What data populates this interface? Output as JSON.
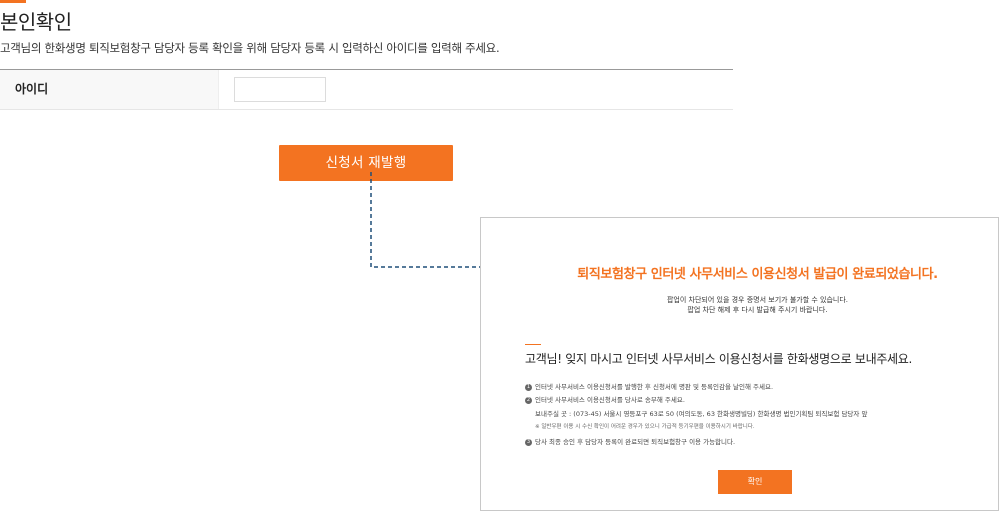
{
  "header": {
    "title": "본인확인",
    "description": "고객님의 한화생명 퇴직보험창구 담당자 등록 확인을 위해 담당자 등록 시 입력하신 아이디를 입력해 주세요."
  },
  "form": {
    "id_label": "아이디",
    "id_value": ""
  },
  "actions": {
    "reissue_label": "신청서 재발행"
  },
  "popup": {
    "title": "퇴직보험창구 인터넷 사무서비스 이용신청서 발급이 완료되었습니다.",
    "sub_line1": "팝업이 차단되어 있을 경우 증명서 보기가 불가할 수 있습니다.",
    "sub_line2": "팝업 차단 해제 후 다시 발급해 주시기 바랍니다.",
    "heading": "고객님! 잊지 마시고 인터넷 사무서비스 이용신청서를 한화생명으로 보내주세요.",
    "notice1_num": "1",
    "notice1": "인터넷 사무서비스 이용신청서를 발행한 후 신청서에 명판 및 등록인감을 날인해 주세요.",
    "notice2_num": "2",
    "notice2": "인터넷 사무서비스 이용신청서를 당사로 송부해 주세요.",
    "address": "보내주실 곳 : (073-45) 서울시 영등포구 63로 50 (여의도동, 63 한화생명빌딩) 한화생명 법인기획팀 퇴직보험 담당자 앞",
    "remark": "※ 일반우편 이용 시 수신 확인이 어려운 경우가 있으니 가급적 등기우편을 이용하시기 바랍니다.",
    "notice3_num": "3",
    "notice3": "당사 최종 승인 후 담당자 등록이 완료되면 퇴직보험창구 이용 가능합니다.",
    "confirm_label": "확인"
  },
  "colors": {
    "accent": "#f37321",
    "arrow": "#1f4e79"
  }
}
